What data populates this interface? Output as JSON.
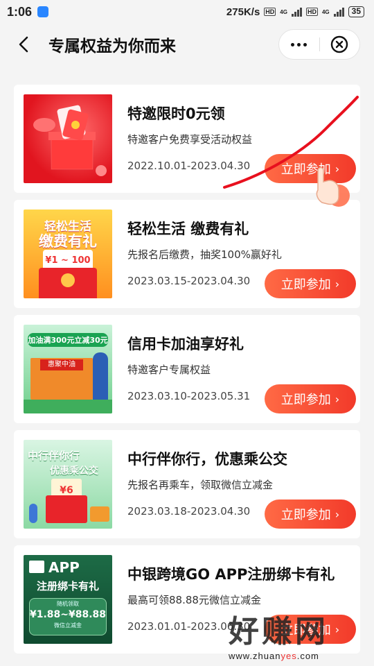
{
  "status": {
    "time": "1:06",
    "speed": "275K/s",
    "battery": "35",
    "hd": "HD",
    "net": "4G"
  },
  "nav": {
    "title": "专属权益为你而来"
  },
  "cards": [
    {
      "title": "特邀限时0元领",
      "desc": "特邀客户免费享受活动权益",
      "date": "2022.10.01-2023.04.30",
      "button": "立即参加"
    },
    {
      "title": "轻松生活 缴费有礼",
      "desc": "先报名后缴费，抽奖100%赢好礼",
      "date": "2023.03.15-2023.04.30",
      "button": "立即参加"
    },
    {
      "title": "信用卡加油享好礼",
      "desc": "特邀客户专属权益",
      "date": "2023.03.10-2023.05.31",
      "button": "立即参加"
    },
    {
      "title": "中行伴你行，优惠乘公交",
      "desc": "先报名再乘车，领取微信立减金",
      "date": "2023.03.18-2023.04.30",
      "button": "立即参加"
    },
    {
      "title": "中银跨境GO APP注册绑卡有礼",
      "desc": "最高可领88.88元微信立减金",
      "date": "2023.01.01-2023.06.30",
      "button": "立即参加"
    }
  ],
  "thumbs": {
    "t2_line1": "轻松生活",
    "t2_line2": "缴费有礼",
    "t2_range": "¥1 ~ 100",
    "t3_line1": "加油满300元立减30元",
    "t3_sign": "惠聚中油",
    "t4_line1": "中行伴你行",
    "t4_line2": "优惠乘公交",
    "t4_num": "¥6",
    "t5_line1": "APP",
    "t5_line2": "注册绑卡有礼",
    "t5_range": "¥1.88~¥88.88",
    "t5_note": "微信立减金",
    "t5_tag": "随机领取"
  },
  "watermark": {
    "big": "好赚网",
    "small_a": "www.zhuan",
    "small_b": "yes",
    "small_c": ".com"
  },
  "colors": {
    "accent": "#f23a2a",
    "scribble": "#e8101e"
  }
}
